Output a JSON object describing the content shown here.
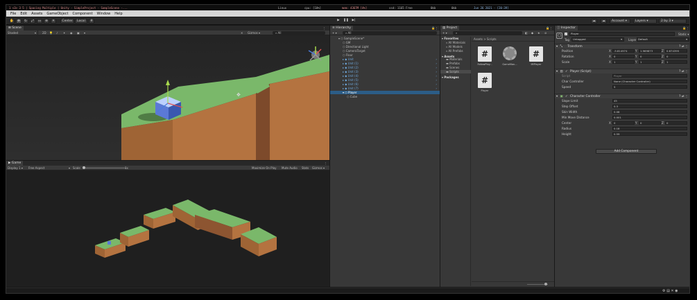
{
  "sysbar": {
    "left": "1  <3> 3  5 | Spacing Multiple | Unity - SimpleProject - SampleScene -...",
    "os": "Linux",
    "cpu": "cpu: [10%]",
    "mem": "mem: 4367M [4%]",
    "ssd": "ssd: 1165 Free",
    "net_up": "0kb",
    "net_down": "0kb",
    "date": "Jun 26 2021 - [20:39]"
  },
  "menu": [
    "File",
    "Edit",
    "Assets",
    "GameObject",
    "Component",
    "Window",
    "Help"
  ],
  "toolbar": {
    "center": "Center",
    "local": "Local",
    "account": "Account",
    "layers": "Layers",
    "layout": "2 by 3"
  },
  "scene": {
    "tab": "Scene",
    "shading": "Shaded",
    "mode_2d": "2D",
    "gizmos": "Gizmos",
    "search_placeholder": "All"
  },
  "game": {
    "tab": "Game",
    "display": "Display 1",
    "aspect": "Free Aspect",
    "scale_label": "Scale",
    "scale_value": "1x",
    "maximize": "Maximize On Play",
    "mute": "Mute Audio",
    "stats": "Stats",
    "gizmos": "Gizmos"
  },
  "hierarchy": {
    "tab": "Hierarchy",
    "search_placeholder": "All",
    "items": [
      {
        "label": "SampleScene*",
        "indent": 0,
        "kind": "scene"
      },
      {
        "label": "GM",
        "indent": 1,
        "kind": "obj"
      },
      {
        "label": "Directional Light",
        "indent": 1,
        "kind": "obj"
      },
      {
        "label": "CameraTarget",
        "indent": 1,
        "kind": "obj"
      },
      {
        "label": "Floor",
        "indent": 1,
        "kind": "obj"
      },
      {
        "label": "Unit",
        "indent": 1,
        "kind": "prefab"
      },
      {
        "label": "Unit (1)",
        "indent": 1,
        "kind": "prefab"
      },
      {
        "label": "Unit (2)",
        "indent": 1,
        "kind": "prefab"
      },
      {
        "label": "Unit (3)",
        "indent": 1,
        "kind": "prefab"
      },
      {
        "label": "Unit (4)",
        "indent": 1,
        "kind": "prefab"
      },
      {
        "label": "Unit (5)",
        "indent": 1,
        "kind": "prefab"
      },
      {
        "label": "Unit (6)",
        "indent": 1,
        "kind": "prefab"
      },
      {
        "label": "Unit (7)",
        "indent": 1,
        "kind": "prefab"
      },
      {
        "label": "Player",
        "indent": 1,
        "kind": "selected"
      },
      {
        "label": "Cube",
        "indent": 2,
        "kind": "obj"
      }
    ]
  },
  "project": {
    "tab": "Project",
    "search_placeholder": "",
    "tree": [
      {
        "label": "Favorites",
        "indent": 0,
        "bold": true
      },
      {
        "label": "All Materials",
        "indent": 1
      },
      {
        "label": "All Models",
        "indent": 1
      },
      {
        "label": "All Prefabs",
        "indent": 1
      },
      {
        "label": "Assets",
        "indent": 0,
        "bold": true
      },
      {
        "label": "Materials",
        "indent": 1
      },
      {
        "label": "Prefabs",
        "indent": 1
      },
      {
        "label": "Scenes",
        "indent": 1
      },
      {
        "label": "Scripts",
        "indent": 1,
        "selected": true
      },
      {
        "label": "Packages",
        "indent": 0,
        "bold": true
      }
    ],
    "breadcrumb": {
      "root": "Assets",
      "sep": ">",
      "leaf": "Scripts"
    },
    "assets": [
      {
        "label": "FollowPlay...",
        "kind": "script",
        "glyph": "#"
      },
      {
        "label": "GameMan...",
        "kind": "gear",
        "glyph": ""
      },
      {
        "label": "IMPlayer",
        "kind": "script",
        "glyph": "#"
      },
      {
        "label": "Player",
        "kind": "script",
        "glyph": "#"
      }
    ]
  },
  "inspector": {
    "tab": "Inspector",
    "object_name": "Player",
    "static": "Static",
    "tag_label": "Tag",
    "tag_value": "Untagged",
    "layer_label": "Layer",
    "layer_value": "Default",
    "transform": {
      "title": "Transform",
      "rows": [
        {
          "label": "Position",
          "x": "-5.814974",
          "y": "1.969873",
          "z": "0.674395"
        },
        {
          "label": "Rotation",
          "x": "0",
          "y": "0",
          "z": "0"
        },
        {
          "label": "Scale",
          "x": "1",
          "y": "1",
          "z": "1"
        }
      ],
      "axes": [
        "X",
        "Y",
        "Z"
      ]
    },
    "player_script": {
      "title": "Player (Script)",
      "rows": [
        {
          "label": "Script",
          "value": "Player"
        },
        {
          "label": "Char Controller",
          "value": "None (Character Controller)"
        },
        {
          "label": "Speed",
          "value": "5"
        }
      ]
    },
    "char_controller": {
      "title": "Character Controller",
      "rows": [
        {
          "label": "Slope Limit",
          "value": "45"
        },
        {
          "label": "Step Offset",
          "value": "0.3"
        },
        {
          "label": "Skin Width",
          "value": "0.08"
        },
        {
          "label": "Min Move Distance",
          "value": "0.001"
        },
        {
          "label": "Radius",
          "value": "0.18"
        },
        {
          "label": "Height",
          "value": "0.59"
        }
      ],
      "center": {
        "label": "Center",
        "x": "0",
        "y": "0",
        "z": "0"
      }
    },
    "add_component": "Add Component"
  },
  "colors": {
    "grass": "#7ab86a",
    "dirt_front": "#b47340",
    "dirt_side": "#8d5531",
    "accent": "#4a7cb5",
    "prefab": "#6fa8dc"
  }
}
